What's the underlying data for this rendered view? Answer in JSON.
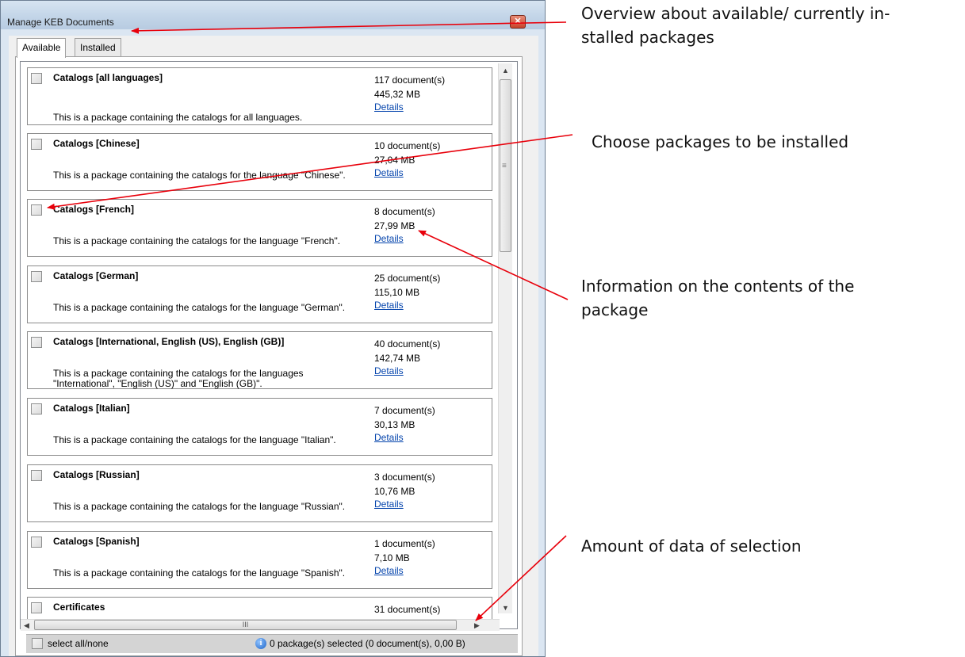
{
  "window": {
    "title": "Manage KEB Documents",
    "close_glyph": "✕"
  },
  "tabs": [
    {
      "label": "Available",
      "active": true
    },
    {
      "label": "Installed",
      "active": false
    }
  ],
  "packages": [
    {
      "name": "Catalogs [all languages]",
      "description": "This is a package containing the catalogs for all languages.",
      "documents": "117 document(s)",
      "size": "445,32 MB",
      "details": "Details",
      "checked": false
    },
    {
      "name": "Catalogs [Chinese]",
      "description": "This is a package containing the catalogs for the language \"Chinese\".",
      "documents": "10 document(s)",
      "size": "27,04 MB",
      "details": "Details",
      "checked": false
    },
    {
      "name": "Catalogs [French]",
      "description": "This is a package containing the catalogs for the language \"French\".",
      "documents": "8 document(s)",
      "size": "27,99 MB",
      "details": "Details",
      "checked": false
    },
    {
      "name": "Catalogs [German]",
      "description": "This is a package containing the catalogs for the language \"German\".",
      "documents": "25 document(s)",
      "size": "115,10 MB",
      "details": "Details",
      "checked": false
    },
    {
      "name": "Catalogs [International, English (US), English (GB)]",
      "description": "This is a package containing the catalogs for the languages \"International\", \"English (US)\" and \"English (GB)\".",
      "documents": "40 document(s)",
      "size": "142,74 MB",
      "details": "Details",
      "checked": false
    },
    {
      "name": "Catalogs [Italian]",
      "description": "This is a package containing the catalogs for the language \"Italian\".",
      "documents": "7 document(s)",
      "size": "30,13 MB",
      "details": "Details",
      "checked": false
    },
    {
      "name": "Catalogs [Russian]",
      "description": "This is a package containing the catalogs for the language \"Russian\".",
      "documents": "3 document(s)",
      "size": "10,76 MB",
      "details": "Details",
      "checked": false
    },
    {
      "name": "Catalogs [Spanish]",
      "description": "This is a package containing the catalogs for the language \"Spanish\".",
      "documents": "1 document(s)",
      "size": "7,10 MB",
      "details": "Details",
      "checked": false
    },
    {
      "name": "Certificates",
      "description": "",
      "documents": "31 document(s)",
      "size": "",
      "details": "",
      "checked": false
    }
  ],
  "scrollbar": {
    "up_arrow": "▲",
    "down_arrow": "▼",
    "left_arrow": "◀",
    "right_arrow": "▶",
    "h_grip": "III",
    "v_grip": "≡"
  },
  "footer": {
    "select_all_label": "select all/none",
    "info_icon": "i",
    "status": "0 package(s) selected (0 document(s), 0,00 B)"
  },
  "annotations": {
    "overview": "Overview about available/ currently in-\nstalled packages",
    "choose": "Choose packages to be installed",
    "information": "Information on the contents of the\npackage",
    "amount": "Amount of data of selection",
    "arrow_color": "#e8000b"
  }
}
